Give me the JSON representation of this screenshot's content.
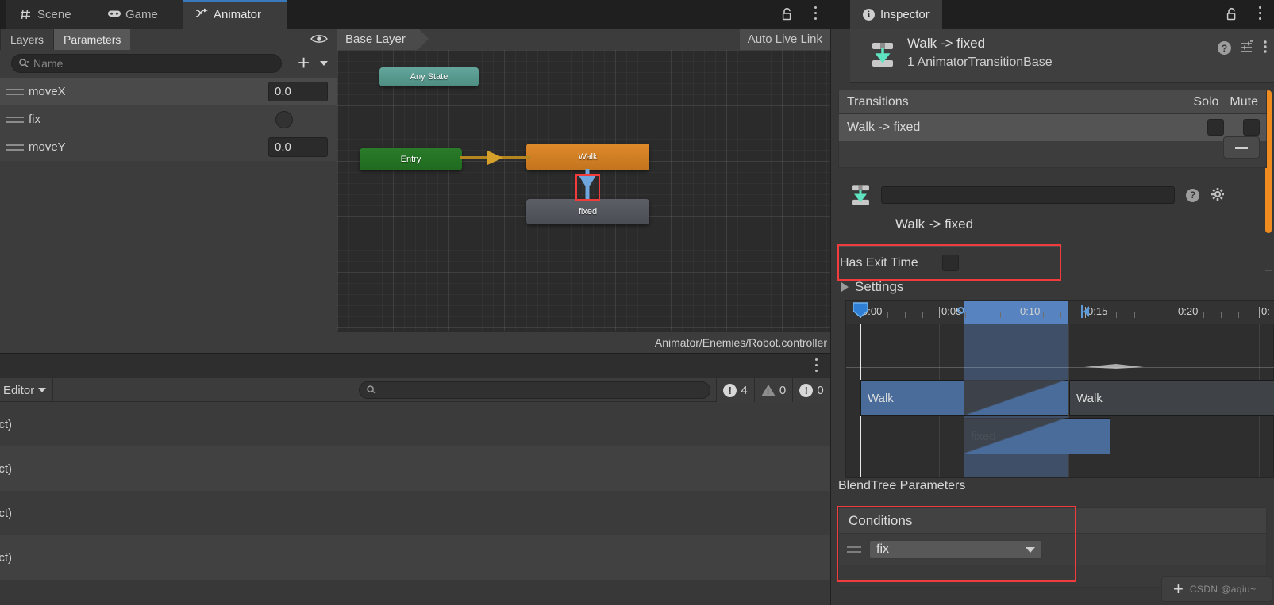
{
  "window_tabs": [
    {
      "label": "Scene",
      "icon": "grid-icon",
      "active": false
    },
    {
      "label": "Game",
      "icon": "gamepad-icon",
      "active": false
    },
    {
      "label": "Animator",
      "icon": "animator-arrow-icon",
      "active": true
    }
  ],
  "parameters_panel": {
    "tabs": [
      {
        "label": "Layers",
        "selected": false
      },
      {
        "label": "Parameters",
        "selected": true
      }
    ],
    "search_placeholder": "Name",
    "add_label": "+",
    "rows": [
      {
        "name": "moveX",
        "type": "float",
        "value": "0.0"
      },
      {
        "name": "fix",
        "type": "bool",
        "value": ""
      },
      {
        "name": "moveY",
        "type": "float",
        "value": "0.0"
      }
    ]
  },
  "graph": {
    "breadcrumb": "Base Layer",
    "live_link_label": "Auto Live Link",
    "status_path": "Animator/Enemies/Robot.controller",
    "nodes": [
      {
        "id": "any",
        "label": "Any State",
        "kind": "any"
      },
      {
        "id": "entry",
        "label": "Entry",
        "kind": "entry"
      },
      {
        "id": "walk",
        "label": "Walk",
        "kind": "default"
      },
      {
        "id": "fixed",
        "label": "fixed",
        "kind": "normal"
      }
    ]
  },
  "console": {
    "filter_label": "Editor",
    "search_value": "",
    "counts": {
      "errors": "4",
      "warnings": "0",
      "infos": "0"
    },
    "rows": [
      {
        "text": "ect)"
      },
      {
        "text": "ect)"
      },
      {
        "text": "ect)"
      },
      {
        "text": "ect)"
      }
    ]
  },
  "inspector": {
    "tab_label": "Inspector",
    "header": {
      "title": "Walk -> fixed",
      "subtitle": "1 AnimatorTransitionBase"
    },
    "transitions": {
      "header_label": "Transitions",
      "solo_label": "Solo",
      "mute_label": "Mute",
      "rows": [
        {
          "label": "Walk -> fixed",
          "solo": false,
          "mute": false
        }
      ],
      "remove_label": "−"
    },
    "detail": {
      "object_field_value": "",
      "transition_name": "Walk -> fixed",
      "has_exit_time_label": "Has Exit Time",
      "has_exit_time_checked": false,
      "settings_label": "Settings"
    },
    "timeline": {
      "time_labels": [
        "0:00",
        "0:05",
        "0:10",
        "0:15",
        "0:20",
        "0:"
      ],
      "tracks": [
        {
          "clips": [
            {
              "label": "Walk",
              "style": "blue"
            },
            {
              "label": "Walk",
              "style": "grey"
            }
          ]
        },
        {
          "clips": [
            {
              "label": "fixed",
              "style": "blue"
            }
          ]
        }
      ]
    },
    "blendtree_params_label": "BlendTree Parameters",
    "conditions": {
      "header_label": "Conditions",
      "rows": [
        {
          "parameter": "fix"
        }
      ]
    },
    "add_button_label": "",
    "watermark": "CSDN @aqiu~"
  },
  "colors": {
    "accent_blue": "#3a79bb",
    "highlight_red": "#f23b3b",
    "walk_node": "#e08a2a",
    "entry_node": "#2a7b2a",
    "any_state_node": "#63a69b",
    "scrollbar_orange": "#f08b20",
    "transition_teal": "#5fe3c0"
  }
}
